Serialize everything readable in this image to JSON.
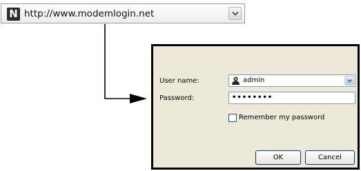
{
  "address_bar": {
    "site_icon_letter": "N",
    "url": "http://www.modemlogin.net",
    "dropdown_icon": "chevron-down-icon"
  },
  "dialog": {
    "username_label": "User name:",
    "username_value": "admin",
    "username_icon": "user-icon",
    "password_label": "Password:",
    "password_value": "••••••••",
    "remember_label": "Remember my password",
    "remember_checked": false,
    "ok_label": "OK",
    "cancel_label": "Cancel"
  },
  "colors": {
    "dialog_background": "#ece9d8",
    "input_border": "#7f9db9",
    "button_border": "#003c74"
  }
}
